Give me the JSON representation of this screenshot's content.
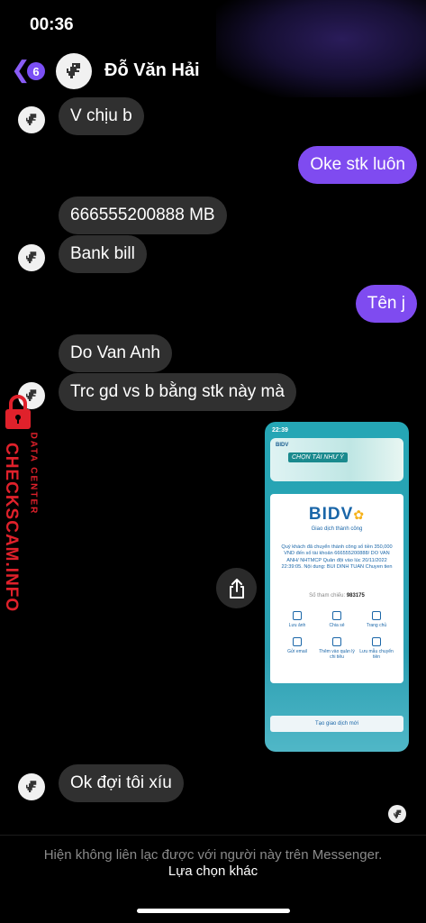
{
  "status_bar": {
    "time": "00:36"
  },
  "header": {
    "back_count": "6",
    "contact_name": "Đỗ Văn Hải",
    "accent_color": "#7f4bf0"
  },
  "messages": [
    {
      "side": "in",
      "text": "V chịu b"
    },
    {
      "side": "out",
      "text": "Oke stk luôn"
    },
    {
      "side": "in",
      "text": "666555200888 MB"
    },
    {
      "side": "in",
      "text": "Bank bill"
    },
    {
      "side": "out",
      "text": "Tên j"
    },
    {
      "side": "in",
      "text": "Do Van Anh"
    },
    {
      "side": "in",
      "text": "Trc gd vs b bằng stk này mà"
    },
    {
      "side": "in",
      "text": "Ok đợi tôi xíu"
    }
  ],
  "receipt": {
    "time": "22:39",
    "banner_logo": "BIDV",
    "banner_text": "CHỌN TÀI NHƯ Ý",
    "brand": "BIDV",
    "title": "Giao dịch thành công",
    "body": "Quý khách đã chuyển thành công số tiền 350,000 VND đến số tài khoản 666555200888/ DO VAN ANH/ NHTMCP Quân đội vào lúc 20/11/2022 22:39:05. Nội dung: BUI DINH TUAN Chuyen tien",
    "ref_label": "Số tham chiếu:",
    "ref_value": "983175",
    "actions": [
      "Lưu ảnh",
      "Chia sẻ",
      "Trang chủ",
      "Gửi email",
      "Thêm vào quản lý chi tiêu",
      "Lưu mẫu chuyển tiền"
    ],
    "new_button": "Tạo giao dịch mới"
  },
  "watermark": {
    "main": "CHECKSCAM.INFO",
    "sub": "DATA CENTER"
  },
  "footer": {
    "note": "Hiện không liên lạc được với người này trên Messenger.",
    "link": "Lựa chọn khác"
  }
}
